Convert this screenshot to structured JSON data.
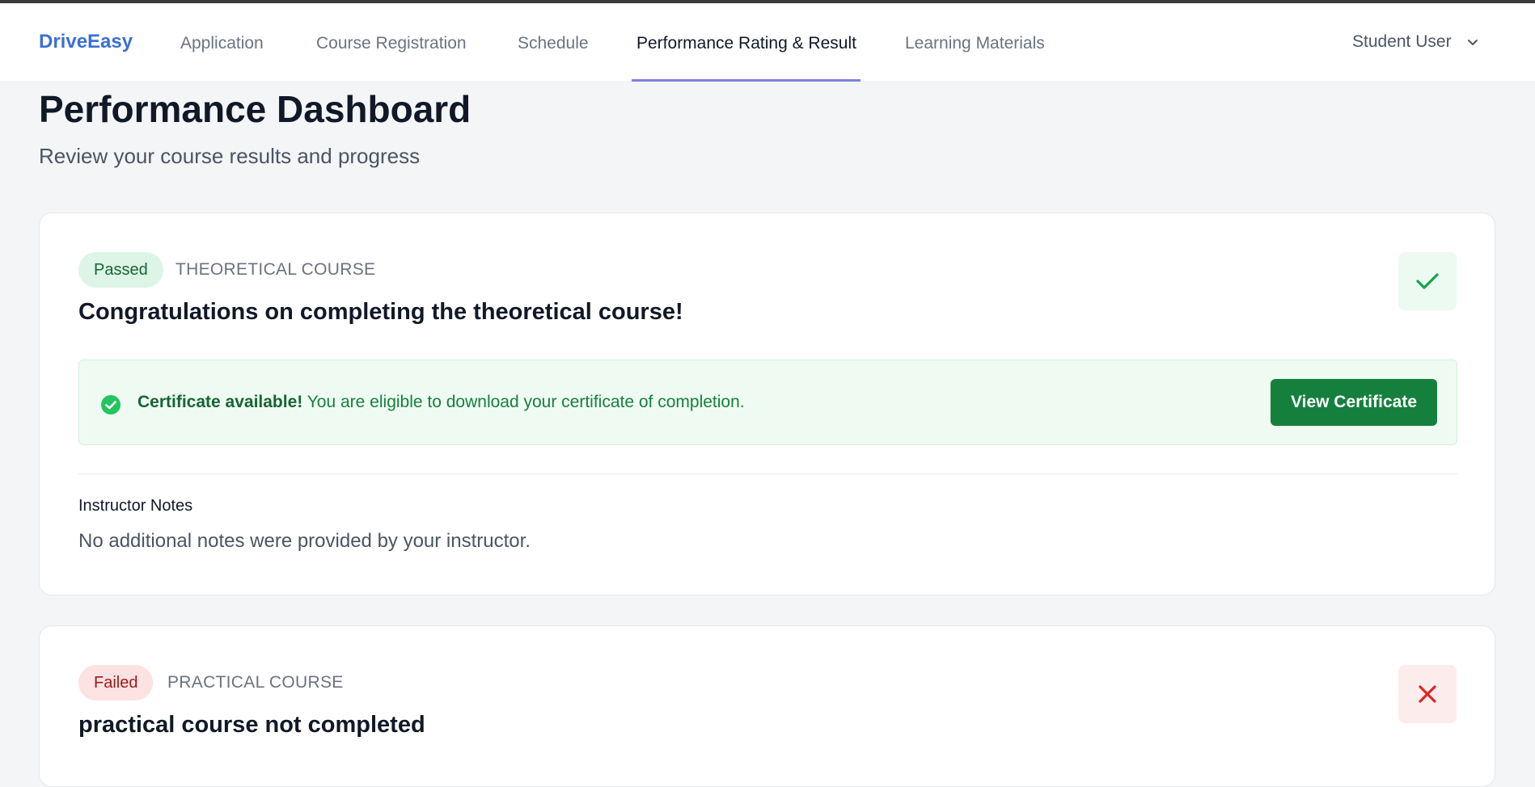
{
  "nav": {
    "brand": "DriveEasy",
    "items": [
      {
        "label": "Application"
      },
      {
        "label": "Course Registration"
      },
      {
        "label": "Schedule"
      },
      {
        "label": "Performance Rating & Result"
      },
      {
        "label": "Learning Materials"
      }
    ],
    "active_item": "Performance Rating & Result",
    "user_label": "Student User",
    "user_icon": "chevron-down-icon"
  },
  "header": {
    "title": "Performance Dashboard",
    "subtitle": "Review your course results and progress"
  },
  "courses": [
    {
      "status": "Passed",
      "type": "THEORETICAL COURSE",
      "heading": "Congratulations on completing the theoretical course!",
      "status_icon": "check-icon",
      "certificate": {
        "title": "Certificate available!",
        "message": " You are eligible to download your certificate of completion.",
        "button_label": "View Certificate"
      },
      "notes_label": "Instructor Notes",
      "notes_text": "No additional notes were provided by your instructor."
    },
    {
      "status": "Failed",
      "type": "PRACTICAL COURSE",
      "heading": "practical course not completed",
      "status_icon": "x-icon"
    }
  ],
  "colors": {
    "brand": "#3b6fd4",
    "active_tab_underline": "#7b83e0",
    "success": "#15803d",
    "danger": "#dc2626"
  }
}
